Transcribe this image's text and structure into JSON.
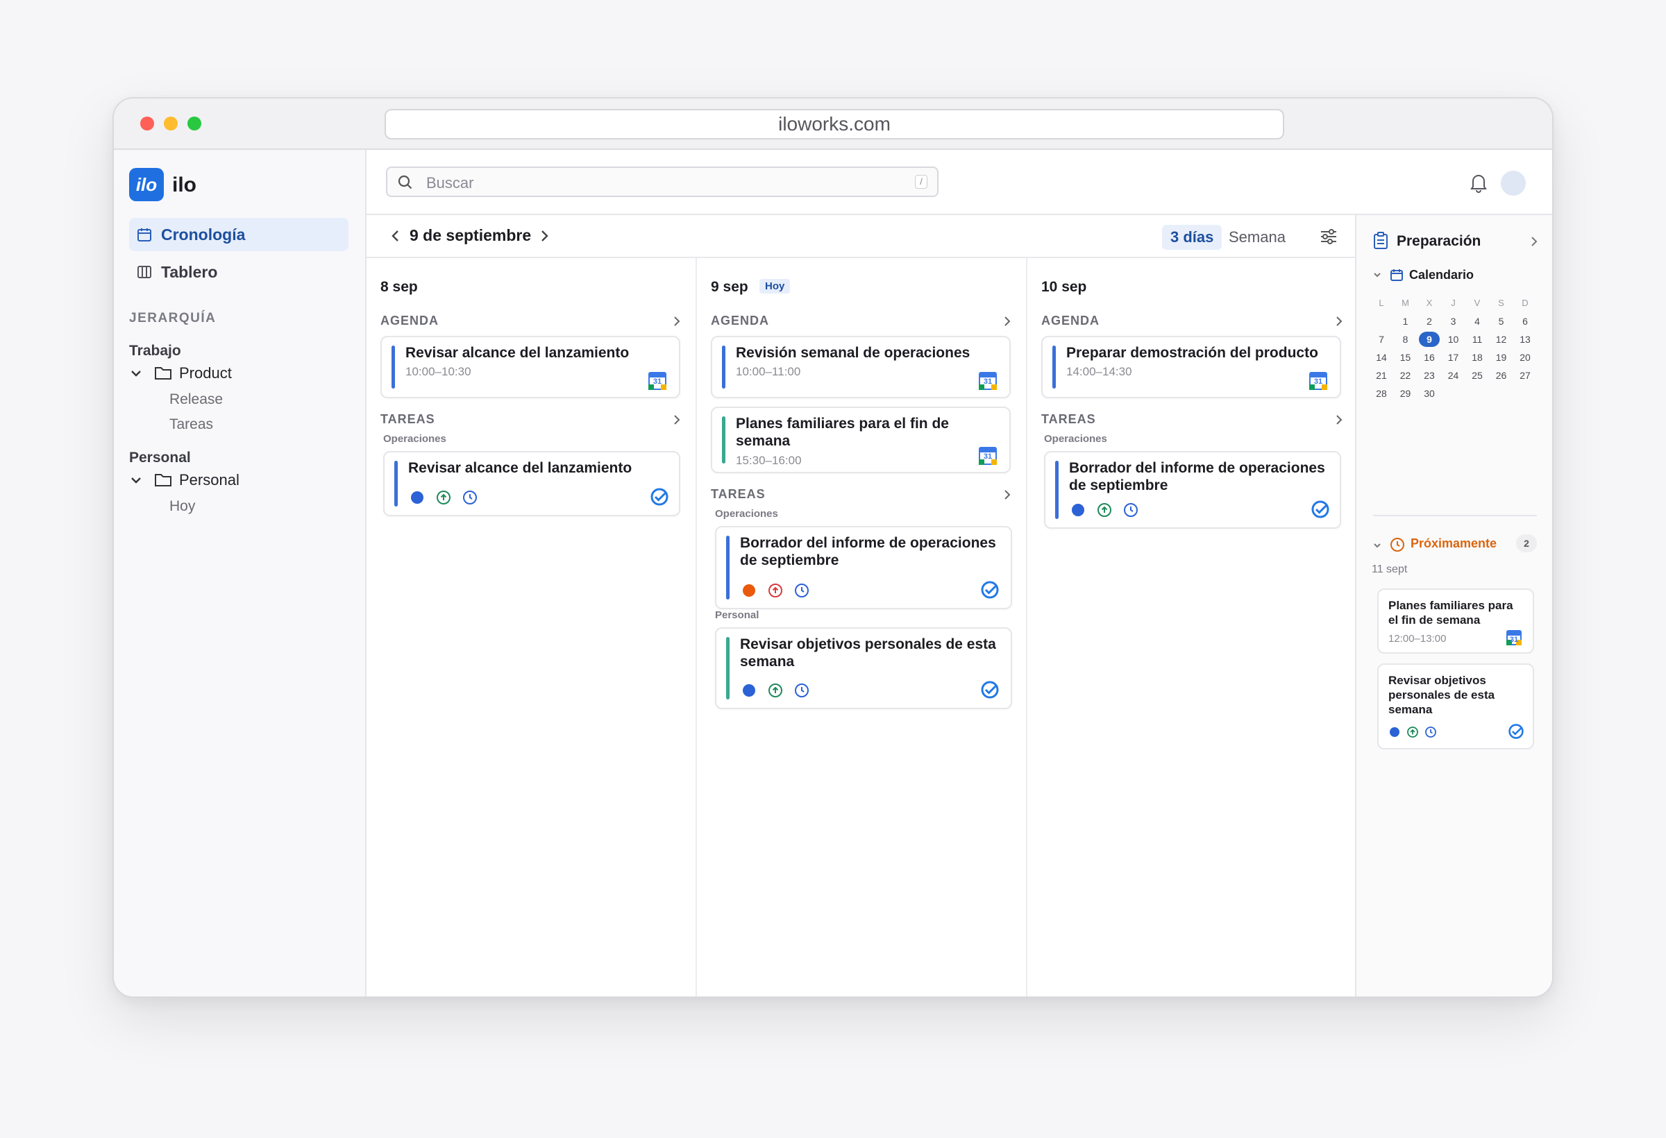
{
  "browser": {
    "url": "iloworks.com"
  },
  "app": {
    "logo_text": "ilo",
    "name": "ilo"
  },
  "sidebar": {
    "nav": [
      {
        "label": "Cronología",
        "icon": "calendar-icon",
        "active": true
      },
      {
        "label": "Tablero",
        "icon": "board-columns-icon",
        "active": false
      }
    ],
    "hierarchy_label": "JERARQUÍA",
    "groups": [
      {
        "label": "Trabajo",
        "folder": "Product",
        "children": [
          "Release",
          "Tareas"
        ]
      },
      {
        "label": "Personal",
        "folder": "Personal",
        "children": [
          "Hoy"
        ]
      }
    ]
  },
  "topbar": {
    "search_placeholder": "Buscar",
    "search_shortcut": "/"
  },
  "datebar": {
    "current": "9 de septiembre",
    "views": [
      "3 días",
      "Semana"
    ],
    "active_view": "3 días"
  },
  "columns": [
    {
      "day": "8 sep",
      "agenda_label": "AGENDA",
      "tasks_label": "TAREAS",
      "agenda": [
        {
          "title": "Revisar alcance del lanzamiento",
          "time": "10:00–10:30",
          "accent": "#3b6fd8"
        }
      ],
      "task_groups": [
        {
          "label": "Operaciones",
          "tasks": [
            {
              "title": "Revisar alcance del lanzamiento",
              "status": "#2b62d6",
              "priority_color": "#1f8a5b"
            }
          ]
        }
      ]
    },
    {
      "day": "9 sep",
      "today_badge": "Hoy",
      "agenda_label": "AGENDA",
      "tasks_label": "TAREAS",
      "agenda": [
        {
          "title": "Revisión semanal de operaciones",
          "time": "10:00–11:00",
          "accent": "#3b6fd8"
        },
        {
          "title": "Planes familiares para el fin de semana",
          "time": "15:30–16:00",
          "accent": "#3aa88f"
        }
      ],
      "task_groups": [
        {
          "label": "Operaciones",
          "tasks": [
            {
              "title": "Borrador del informe de operaciones de septiembre",
              "status": "#ea5a0c",
              "priority_color": "#d93b3b"
            }
          ]
        },
        {
          "label": "Personal",
          "tasks": [
            {
              "title": "Revisar objetivos personales de esta semana",
              "status": "#2b62d6",
              "priority_color": "#1f8a5b"
            }
          ]
        }
      ]
    },
    {
      "day": "10 sep",
      "agenda_label": "AGENDA",
      "tasks_label": "TAREAS",
      "agenda": [
        {
          "title": "Preparar demostración del producto",
          "time": "14:00–14:30",
          "accent": "#3b6fd8"
        }
      ],
      "task_groups": [
        {
          "label": "Operaciones",
          "tasks": [
            {
              "title": "Borrador del informe de operaciones de septiembre",
              "status": "#2b62d6",
              "priority_color": "#1f8a5b"
            }
          ]
        }
      ]
    }
  ],
  "right_panel": {
    "title": "Preparación",
    "calendar_label": "Calendario",
    "weekdays": [
      "L",
      "M",
      "X",
      "J",
      "V",
      "S",
      "D"
    ],
    "weeks": [
      [
        "",
        "1",
        "2",
        "3",
        "4",
        "5",
        "6"
      ],
      [
        "7",
        "8",
        "9",
        "10",
        "11",
        "12",
        "13"
      ],
      [
        "14",
        "15",
        "16",
        "17",
        "18",
        "19",
        "20"
      ],
      [
        "21",
        "22",
        "23",
        "24",
        "25",
        "26",
        "27"
      ],
      [
        "28",
        "29",
        "30",
        "",
        "",
        "",
        ""
      ]
    ],
    "today": "9",
    "upcoming_label": "Próximamente",
    "upcoming_count": "2",
    "upcoming_date": "11 sept",
    "upcoming": [
      {
        "title": "Planes familiares para el fin de semana",
        "time": "12:00–13:00",
        "kind": "event"
      },
      {
        "title": "Revisar objetivos personales de esta semana",
        "kind": "task"
      }
    ]
  },
  "colors": {
    "accent": "#1f6fe0",
    "today": "#2a66c9",
    "upcoming": "#d9650f"
  }
}
